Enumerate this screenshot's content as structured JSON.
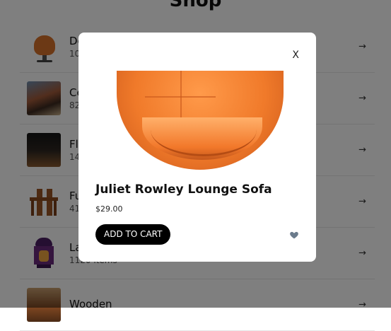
{
  "page": {
    "title": "Shop"
  },
  "categories": [
    {
      "name": "De",
      "count": "10",
      "thumb": "chair"
    },
    {
      "name": "Ce",
      "count": "82",
      "thumb": "ceiling"
    },
    {
      "name": "Fl",
      "count": "14",
      "thumb": "floor"
    },
    {
      "name": "Fu",
      "count": "41",
      "thumb": "furniture"
    },
    {
      "name": "La",
      "count": "1120 items",
      "thumb": "lamp"
    },
    {
      "name": "Wooden",
      "count": "",
      "thumb": "wooden"
    }
  ],
  "arrow": "→",
  "modal": {
    "close_label": "X",
    "product_name": "Juliet Rowley Lounge Sofa",
    "price": "$29.00",
    "add_to_cart_label": "ADD TO CART",
    "favorite_icon": "heart-icon",
    "favorite_color": "#6b7b8c"
  },
  "colors": {
    "overlay": "rgba(0,0,0,0.5)",
    "button_bg": "#000000",
    "chair_orange": "#f07a2a"
  }
}
